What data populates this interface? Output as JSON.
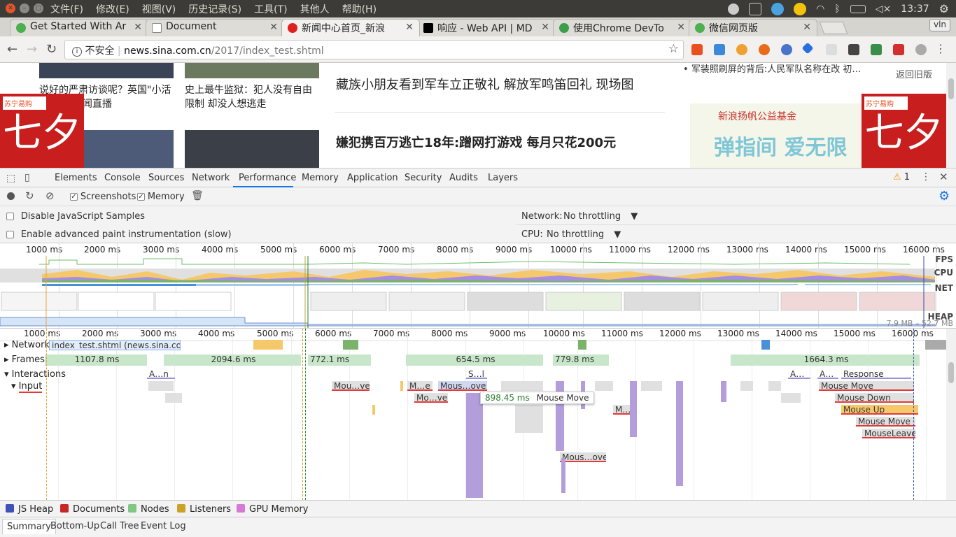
{
  "os_menu": {
    "items": [
      "文件(F)",
      "修改(E)",
      "视图(V)",
      "历史记录(S)",
      "工具(T)",
      "其他人",
      "帮助(H)"
    ],
    "clock": "13:37"
  },
  "tabs": [
    {
      "title": "Get Started With Ar",
      "favicon_color": "#4caf50"
    },
    {
      "title": "Document",
      "favicon_color": "#888888"
    },
    {
      "title": "新闻中心首页_新浪",
      "favicon_color": "#e0201f"
    },
    {
      "title": "响应 - Web API | MD",
      "favicon_color": "#000000"
    },
    {
      "title": "使用Chrome DevTo",
      "favicon_color": "#3a9e4b"
    },
    {
      "title": "微信网页版",
      "favicon_color": "#4caf50"
    }
  ],
  "profile_label": "vln",
  "address": {
    "security": "不安全",
    "host": "news.sina.com.cn",
    "path": "/2017/index_test.shtml"
  },
  "page": {
    "captions": [
      "说好的严肃访谈呢？英国\"小活",
      "闻直播",
      "史上最牛监狱：犯人没有自由",
      "限制 却没人想逃走"
    ],
    "headline1": "藏族小朋友看到军车立正敬礼 解放军鸣笛回礼   现场图",
    "headline2": "嫌犯携百万逃亡18年:蹭网打游戏 每月只花200元",
    "side_news": "军装照刷屏的背后:人民军队名称在改 初…",
    "back_old": "返回旧版",
    "ad_foundation": "新浪扬帆公益基金",
    "ad_slogan": "弹指间 爱无限",
    "suning": "苏宁易购"
  },
  "devtools": {
    "tabs": [
      "Elements",
      "Console",
      "Sources",
      "Network",
      "Performance",
      "Memory",
      "Application",
      "Security",
      "Audits",
      "Layers"
    ],
    "active_tab": "Performance",
    "warning_count": "1",
    "toolbar": {
      "screenshots": "Screenshots",
      "memory": "Memory"
    },
    "settings": {
      "disable_js": "Disable JavaScript Samples",
      "adv_paint": "Enable advanced paint instrumentation (slow)",
      "network_label": "Network:",
      "network_value": "No throttling",
      "cpu_label": "CPU:",
      "cpu_value": "No throttling"
    },
    "overview_ticks": [
      "1000 ms",
      "2000 ms",
      "3000 ms",
      "4000 ms",
      "5000 ms",
      "6000 ms",
      "7000 ms",
      "8000 ms",
      "9000 ms",
      "10000 ms",
      "11000 ms",
      "12000 ms",
      "13000 ms",
      "14000 ms",
      "15000 ms",
      "16000 ms"
    ],
    "overview_labels": {
      "fps": "FPS",
      "cpu": "CPU",
      "net": "NET",
      "heap": "HEAP",
      "heap_range": "7.9 MB – 52.7 MB"
    },
    "flame_ticks": [
      "1000 ms",
      "2000 ms",
      "3000 ms",
      "4000 ms",
      "5000 ms",
      "6000 ms",
      "7000 ms",
      "8000 ms",
      "9000 ms",
      "10000 ms",
      "11000 ms",
      "12000 ms",
      "13000 ms",
      "14000 ms",
      "15000 ms",
      "16000 ms"
    ],
    "tracks": {
      "network": "Network",
      "network_item": "index_test.shtml (news.sina.co…",
      "frames": "Frames",
      "interactions": "Interactions",
      "input": "Input"
    },
    "frames": [
      "1107.8 ms",
      "2094.6 ms",
      "772.1 ms",
      "654.5 ms",
      "779.8 ms",
      "1664.3 ms"
    ],
    "interaction_labels": [
      "A…n",
      "S…l",
      "A…",
      "A…",
      "Response"
    ],
    "input_blocks": [
      "Mou…ve",
      "M…e",
      "Mous…ove",
      "Mo…ve",
      "M…",
      "Mous…ove",
      "Mouse Move",
      "Mouse Down",
      "Mouse Up",
      "Mouse Move",
      "MouseLeave"
    ],
    "tooltip": {
      "time": "898.45 ms",
      "label": "Mouse Move"
    },
    "counters": [
      "JS Heap",
      "Documents",
      "Nodes",
      "Listeners",
      "GPU Memory"
    ],
    "counter_colors": [
      "#3f51b5",
      "#c62828",
      "#81c784",
      "#c9a227",
      "#d67ad6"
    ],
    "bottom_tabs": [
      "Summary",
      "Bottom-Up",
      "Call Tree",
      "Event Log"
    ]
  }
}
